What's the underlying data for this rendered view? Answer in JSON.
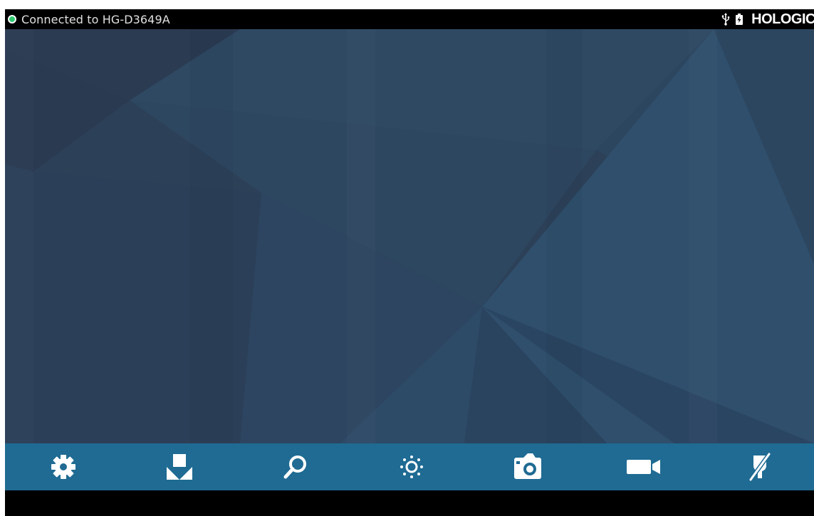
{
  "status_bar": {
    "connection_text": "Connected to HG-D3649A",
    "connection_status_color": "#2ecc71",
    "usb_icon": "usb-icon",
    "battery_icon": "battery-charging-icon",
    "brand": "HOLOGIC"
  },
  "toolbar": {
    "background_color": "#1f6b93",
    "items": [
      {
        "icon": "gear-icon",
        "action": "settings"
      },
      {
        "icon": "import-icon",
        "action": "import"
      },
      {
        "icon": "search-icon",
        "action": "zoom"
      },
      {
        "icon": "brightness-icon",
        "action": "brightness"
      },
      {
        "icon": "camera-icon",
        "action": "capture-photo"
      },
      {
        "icon": "video-camera-icon",
        "action": "record-video"
      },
      {
        "icon": "pen-disabled-icon",
        "action": "annotate-disabled"
      }
    ]
  }
}
